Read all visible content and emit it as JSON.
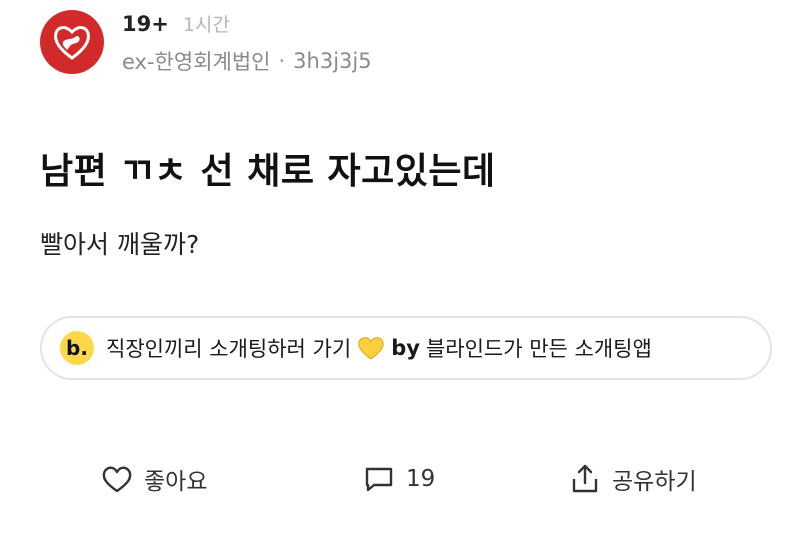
{
  "post": {
    "tag": "19+",
    "time": "1시간",
    "company": "ex-한영회계법인",
    "separator": "·",
    "username": "3h3j3j5",
    "title": "남편 ㄲㅊ 선 채로 자고있는데",
    "body": "빨아서 깨울까?"
  },
  "promo": {
    "logo_letter": "b.",
    "text": "직장인끼리 소개팅하러 가기",
    "by_label": "by",
    "suffix": "블라인드가 만든 소개팅앱"
  },
  "actions": {
    "like_label": "좋아요",
    "comment_count": "19",
    "share_label": "공유하기"
  },
  "colors": {
    "avatar_bg": "#d22a2a",
    "promo_logo_bg": "#ffd84a",
    "muted_text": "#8a8a8a"
  },
  "icons": [
    "heart-outline-icon",
    "comment-icon",
    "share-icon",
    "yellow-heart-emoji"
  ]
}
